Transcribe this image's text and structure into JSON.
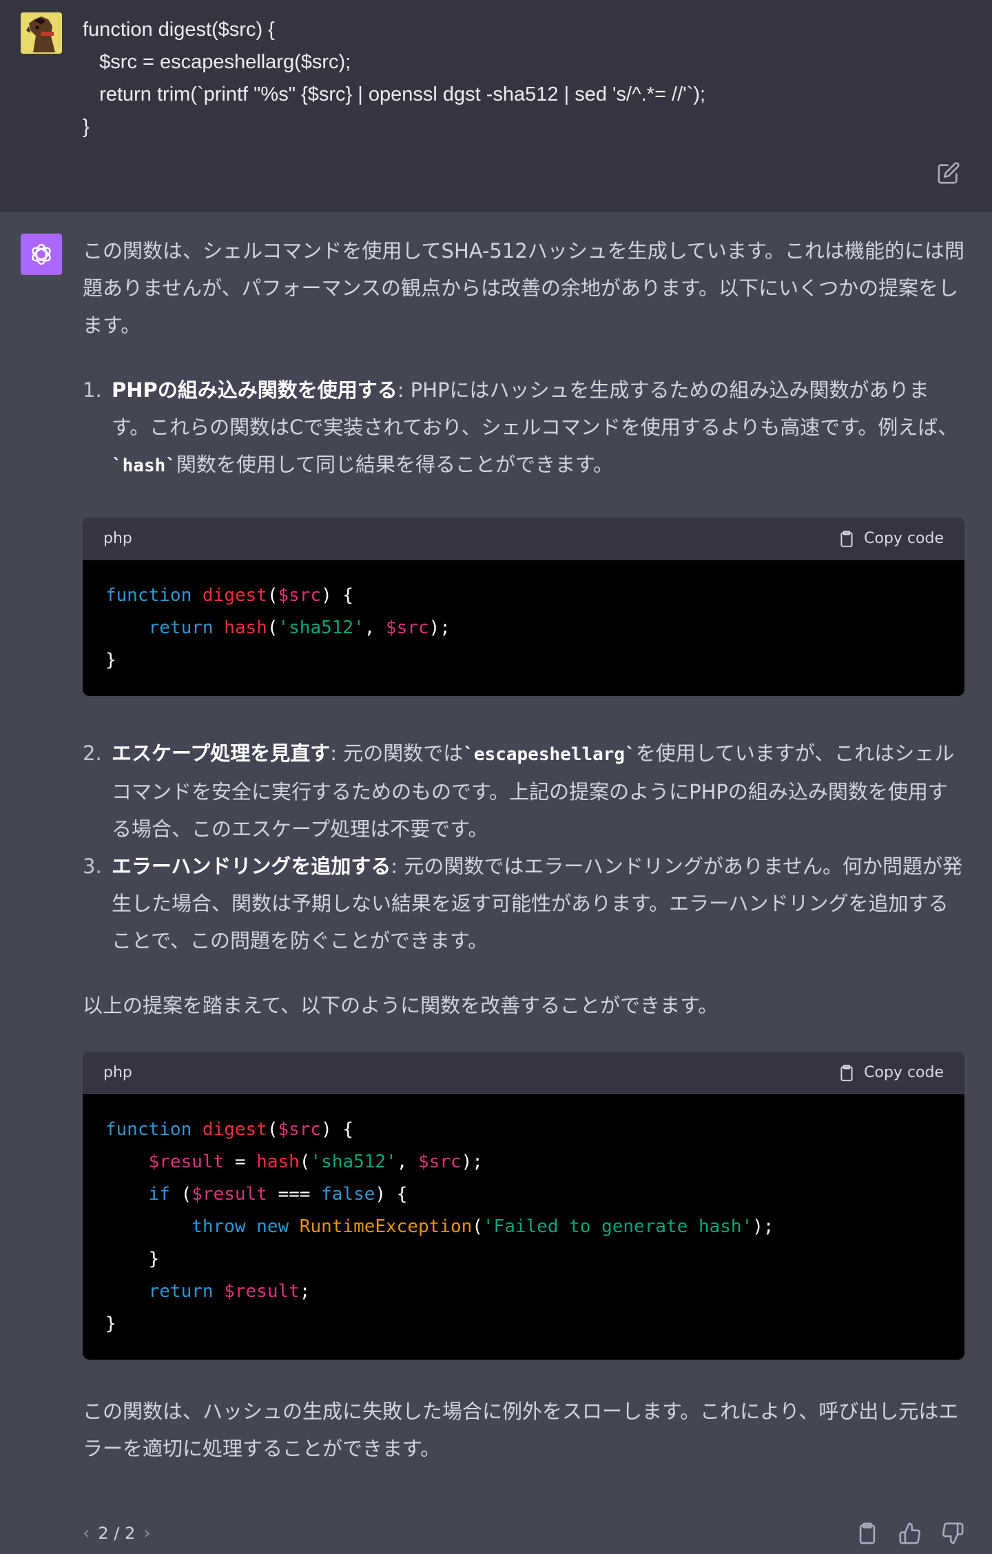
{
  "user_message": {
    "lines": [
      "function digest($src) {",
      "   $src = escapeshellarg($src);",
      "   return trim(`printf \"%s\" {$src} | openssl dgst -sha512 | sed 's/^.*= //'`);",
      "}"
    ]
  },
  "assistant": {
    "intro": "この関数は、シェルコマンドを使用してSHA-512ハッシュを生成しています。これは機能的には問題ありませんが、パフォーマンスの観点からは改善の余地があります。以下にいくつかの提案をします。",
    "item1": {
      "num": "1.",
      "title": "PHPの組み込み関数を使用する",
      "text_a": ": PHPにはハッシュを生成するための組み込み関数があります。これらの関数はCで実装されており、シェルコマンドを使用するよりも高速です。例えば、",
      "code": "`hash`",
      "text_b": "関数を使用して同じ結果を得ることができます。"
    },
    "code1": {
      "lang": "php",
      "copy_label": "Copy code"
    },
    "item2": {
      "num": "2.",
      "title": "エスケープ処理を見直す",
      "text_a": ": 元の関数では",
      "code": "`escapeshellarg`",
      "text_b": "を使用していますが、これはシェルコマンドを安全に実行するためのものです。上記の提案のようにPHPの組み込み関数を使用する場合、このエスケープ処理は不要です。"
    },
    "item3": {
      "num": "3.",
      "title": "エラーハンドリングを追加する",
      "text_a": ": 元の関数ではエラーハンドリングがありません。何か問題が発生した場合、関数は予期しない結果を返す可能性があります。エラーハンドリングを追加することで、この問題を防ぐことができます。"
    },
    "summary": "以上の提案を踏まえて、以下のように関数を改善することができます。",
    "code2": {
      "lang": "php",
      "copy_label": "Copy code"
    },
    "closing": "この関数は、ハッシュの生成に失敗した場合に例外をスローします。これにより、呼び出し元はエラーを適切に処理することができます。"
  },
  "pager": {
    "current": "2 / 2"
  },
  "icons": {
    "edit": "edit-icon",
    "copy": "clipboard-icon",
    "thumbs_up": "thumbs-up-icon",
    "thumbs_down": "thumbs-down-icon",
    "prev": "chevron-left-icon",
    "next": "chevron-right-icon"
  },
  "colors": {
    "user_bg": "#343541",
    "assistant_bg": "#444654",
    "gpt_avatar": "#ab68ff",
    "code_bg": "#000000"
  }
}
